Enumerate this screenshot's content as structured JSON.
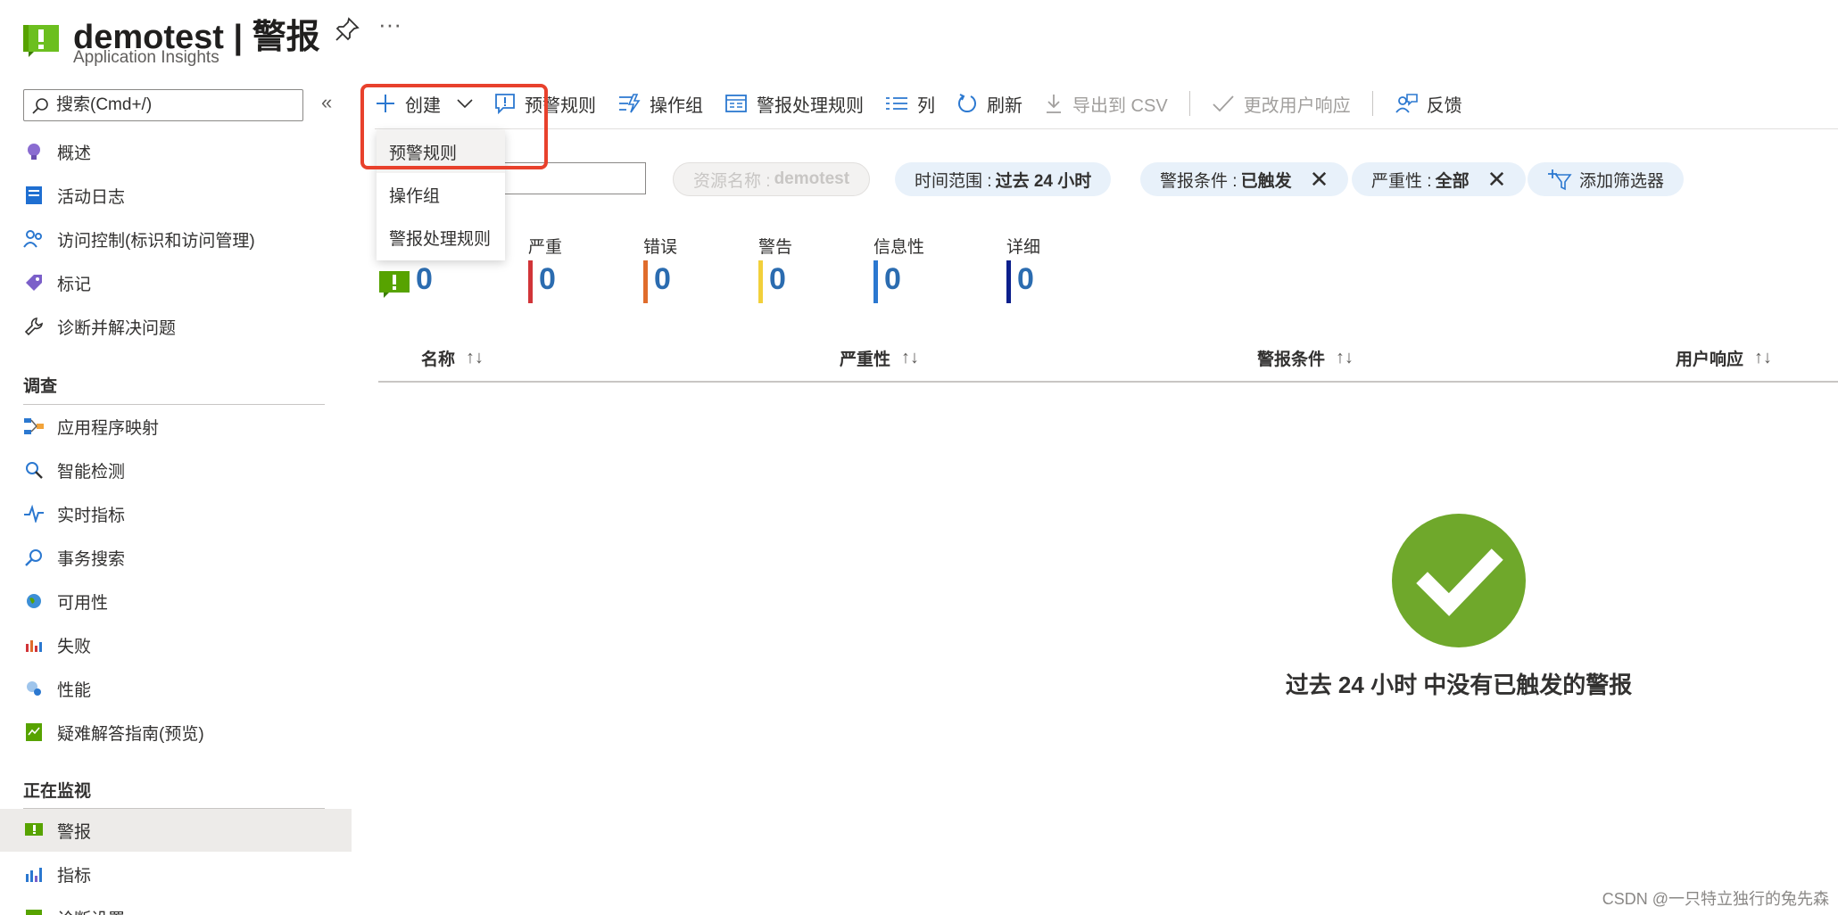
{
  "header": {
    "title": "demotest | 警报",
    "subtitle": "Application Insights",
    "more": "···"
  },
  "sidebar": {
    "search_placeholder": "搜索(Cmd+/)",
    "collapse": "«",
    "items_top": [
      {
        "label": "概述",
        "icon": "lightbulb-icon"
      },
      {
        "label": "活动日志",
        "icon": "activity-log-icon"
      },
      {
        "label": "访问控制(标识和访问管理)",
        "icon": "people-icon"
      },
      {
        "label": "标记",
        "icon": "tag-icon"
      },
      {
        "label": "诊断并解决问题",
        "icon": "wrench-icon"
      }
    ],
    "section_investigate": "调查",
    "items_investigate": [
      {
        "label": "应用程序映射",
        "icon": "app-map-icon"
      },
      {
        "label": "智能检测",
        "icon": "smart-detection-icon"
      },
      {
        "label": "实时指标",
        "icon": "pulse-icon"
      },
      {
        "label": "事务搜索",
        "icon": "search-icon"
      },
      {
        "label": "可用性",
        "icon": "globe-icon"
      },
      {
        "label": "失败",
        "icon": "failures-chart-icon"
      },
      {
        "label": "性能",
        "icon": "performance-icon"
      },
      {
        "label": "疑难解答指南(预览)",
        "icon": "guide-book-icon"
      }
    ],
    "section_monitoring": "正在监视",
    "items_monitoring": [
      {
        "label": "警报",
        "icon": "alert-icon",
        "active": true
      },
      {
        "label": "指标",
        "icon": "metrics-icon"
      },
      {
        "label": "诊断设置",
        "icon": "diagnostic-settings-icon"
      }
    ]
  },
  "toolbar": {
    "create": "创建",
    "alert_rules": "预警规则",
    "action_groups": "操作组",
    "processing_rules": "警报处理规则",
    "columns": "列",
    "refresh": "刷新",
    "export_csv": "导出到 CSV",
    "change_response": "更改用户响应",
    "feedback": "反馈"
  },
  "dropdown": {
    "items": [
      "预警规则",
      "操作组",
      "警报处理规则"
    ]
  },
  "filters": {
    "resource_label": "资源名称 :",
    "resource_value": "demotest",
    "time_label": "时间范围 :",
    "time_value": "过去 24 小时",
    "condition_label": "警报条件 :",
    "condition_value": "已触发",
    "severity_label": "严重性 :",
    "severity_value": "全部",
    "add_filter": "添加筛选器"
  },
  "severity": [
    {
      "name": "",
      "value": "0",
      "color": "#57a300"
    },
    {
      "name": "严重",
      "value": "0",
      "color": "#d13438"
    },
    {
      "name": "错误",
      "value": "0",
      "color": "#e06c2c"
    },
    {
      "name": "警告",
      "value": "0",
      "color": "#f2d03b"
    },
    {
      "name": "信息性",
      "value": "0",
      "color": "#2b78d0"
    },
    {
      "name": "详细",
      "value": "0",
      "color": "#0c1f8c"
    }
  ],
  "table": {
    "columns": [
      "名称",
      "严重性",
      "警报条件",
      "用户响应"
    ],
    "sort_glyph": "↑↓"
  },
  "empty_state": {
    "message": "过去 24 小时 中没有已触发的警报"
  },
  "watermark": "CSDN @一只特立独行的兔先森"
}
